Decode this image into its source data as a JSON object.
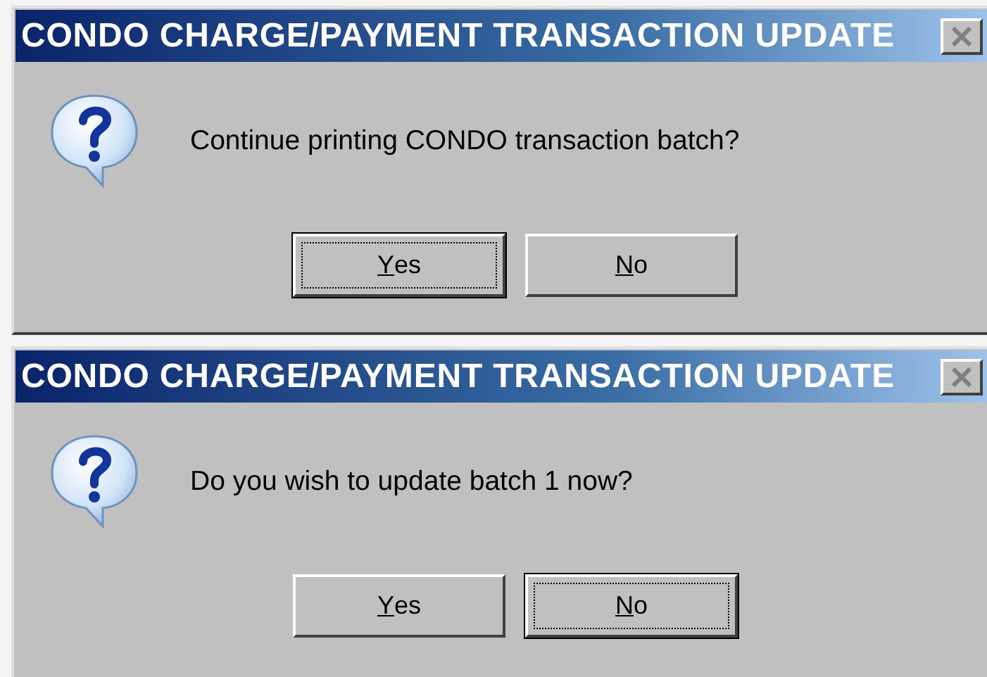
{
  "dialogs": [
    {
      "title": "CONDO CHARGE/PAYMENT TRANSACTION UPDATE",
      "message": "Continue printing CONDO transaction batch?",
      "buttons": [
        {
          "label": "Yes",
          "focused": true
        },
        {
          "label": "No",
          "focused": false
        }
      ]
    },
    {
      "title": "CONDO CHARGE/PAYMENT TRANSACTION UPDATE",
      "message": "Do you wish to update batch 1 now?",
      "buttons": [
        {
          "label": "Yes",
          "focused": false
        },
        {
          "label": "No",
          "focused": true
        }
      ]
    }
  ]
}
